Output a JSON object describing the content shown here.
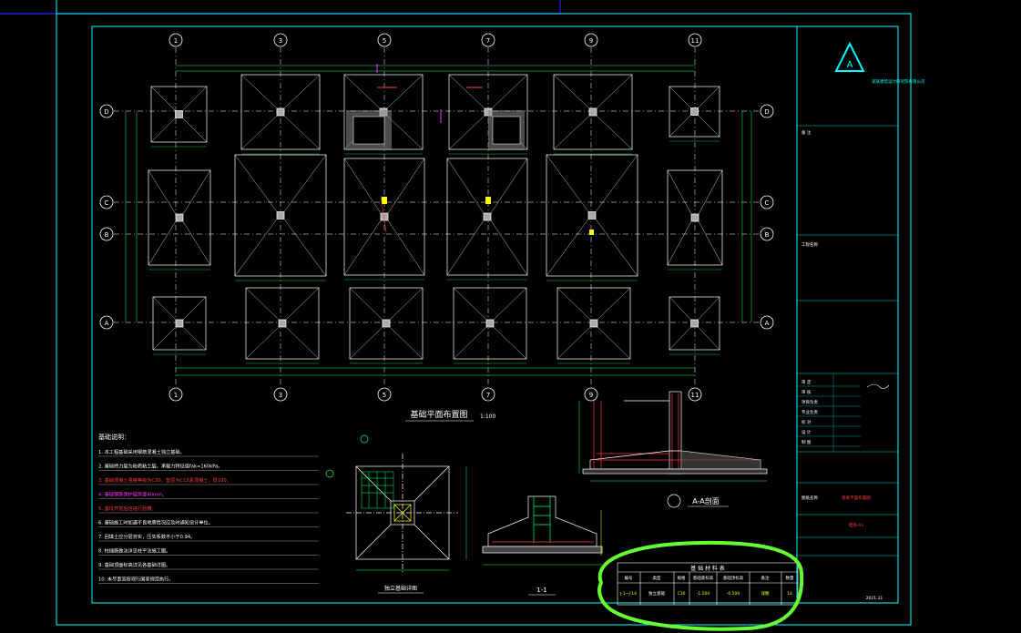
{
  "drawing": {
    "title": "基础平面布置图",
    "scale": "1:100",
    "grid_columns": [
      "1",
      "3",
      "5",
      "7",
      "9",
      "11"
    ],
    "grid_rows": [
      "D",
      "C",
      "B",
      "A"
    ],
    "detail_plan_title": "独立基础详图",
    "section_aa_label": "A-A剖面",
    "section_11_label": "1-1",
    "notes_title": "基础说明：",
    "notes": [
      "1. 本工程基础采用钢筋混凝土独立基础。",
      "2. 基础持力层为粉质粘土层，承载力特征值fak=160kPa。",
      "3. 基础混凝土强度等级为C30，垫层为C15素混凝土，厚100。",
      "4. 基础钢筋保护层厚度40mm。",
      "5. 基坑开挖后应进行验槽。",
      "6. 基础施工时如遇不良地质情况应及时通知设计单位。",
      "7. 回填土应分层夯实，压实系数不小于0.94。",
      "8. 柱插筋做法详见柱平法施工图。",
      "9. 基础顶面标高详见各基础详图。",
      "10. 未尽事宜按现行国家规范执行。"
    ],
    "table_title": "基 础 材 料 表",
    "table_headers": [
      "编号",
      "类型",
      "规格",
      "基础底标高",
      "基础顶标高",
      "备注",
      "数量"
    ],
    "table_row": [
      "J-1~J-14",
      "独立基础",
      "C30",
      "-1.500",
      "-0.500",
      "详图",
      "14"
    ]
  },
  "title_block": {
    "company": "某某建筑设计研究院有限公司",
    "labels": [
      "审 定",
      "审 核",
      "项目负责",
      "专业负责",
      "校 对",
      "设 计",
      "制 图"
    ],
    "project_label": "工程名称",
    "drawing_label": "图纸名称",
    "drawing_name": "基础平面布置图",
    "drawing_no": "结施-03",
    "date": "2021.11"
  },
  "colors": {
    "frame": "#00ffff",
    "outline": "#ffffff",
    "grid": "#ffffff",
    "dimension": "#00ff66",
    "annotation_red": "#ff3b3b",
    "highlight_circle": "#66ff33",
    "magenta": "#ff33ff"
  }
}
